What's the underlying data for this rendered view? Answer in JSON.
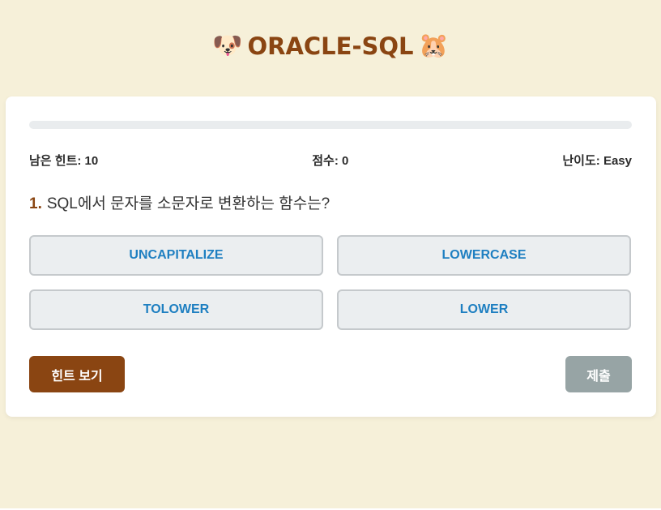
{
  "header": {
    "left_emoji": "🐶",
    "title": "ORACLE-SQL",
    "right_emoji": "🐹"
  },
  "progress": {
    "fraction": 0.0
  },
  "stats": {
    "hints_label": "남은 힌트:",
    "hints_value": "10",
    "score_label": "점수:",
    "score_value": "0",
    "difficulty_label": "난이도:",
    "difficulty_value": "Easy"
  },
  "question": {
    "number": "1.",
    "text": "SQL에서 문자를 소문자로 변환하는 함수는?"
  },
  "options": [
    "UNCAPITALIZE",
    "LOWERCASE",
    "TOLOWER",
    "LOWER"
  ],
  "actions": {
    "hint_label": "힌트 보기",
    "submit_label": "제출"
  },
  "colors": {
    "background": "#f6f0d9",
    "accent": "#8a4512",
    "option_text": "#1e7fc1",
    "submit_disabled": "#97a4a5"
  }
}
